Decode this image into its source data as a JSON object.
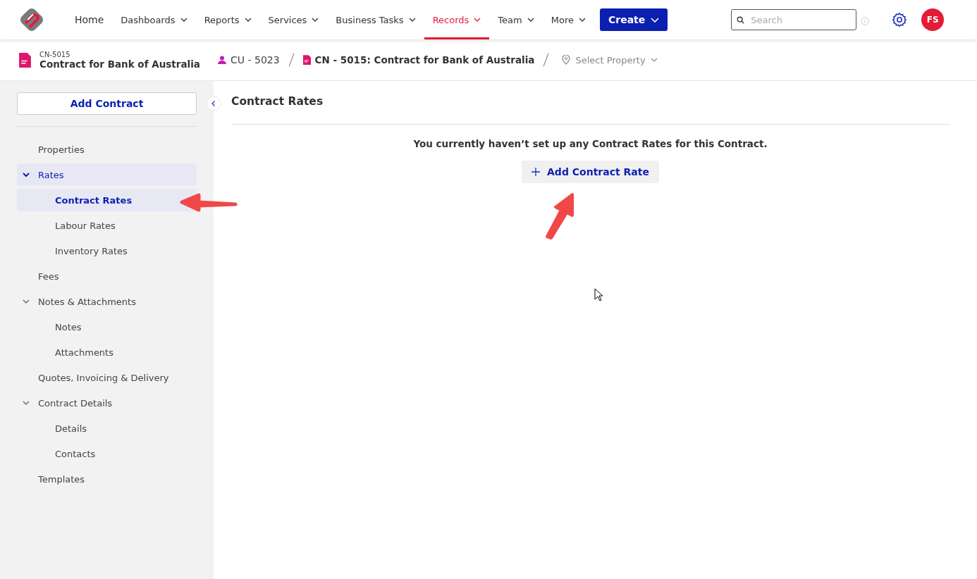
{
  "nav": {
    "items": [
      {
        "label": "Home",
        "dropdown": false,
        "selected": false
      },
      {
        "label": "Dashboards",
        "dropdown": true,
        "selected": false
      },
      {
        "label": "Reports",
        "dropdown": true,
        "selected": false
      },
      {
        "label": "Services",
        "dropdown": true,
        "selected": false
      },
      {
        "label": "Business Tasks",
        "dropdown": true,
        "selected": false
      },
      {
        "label": "Records",
        "dropdown": true,
        "selected": true
      },
      {
        "label": "Team",
        "dropdown": true,
        "selected": false
      },
      {
        "label": "More",
        "dropdown": true,
        "selected": false
      }
    ],
    "create_button": "Create",
    "search": {
      "placeholder": "Search"
    },
    "avatar": "FS"
  },
  "record": {
    "code": "CN-5015",
    "title": "Contract for Bank of Australia"
  },
  "breadcrumb": [
    {
      "kind": "customer",
      "label": "CU - 5023"
    },
    {
      "kind": "contract",
      "label": "CN - 5015: Contract for Bank of Australia"
    },
    {
      "kind": "property",
      "label": "Select Property"
    }
  ],
  "sidebar": {
    "add_button": "Add Contract",
    "items": [
      {
        "label": "Properties",
        "selected": false
      },
      {
        "label": "Rates",
        "selected": true,
        "expanded": true,
        "children": [
          {
            "label": "Contract Rates",
            "selected": true
          },
          {
            "label": "Labour Rates",
            "selected": false
          },
          {
            "label": "Inventory Rates",
            "selected": false
          }
        ]
      },
      {
        "label": "Fees",
        "selected": false
      },
      {
        "label": "Notes & Attachments",
        "selected": false,
        "expanded": true,
        "children": [
          {
            "label": "Notes",
            "selected": false
          },
          {
            "label": "Attachments",
            "selected": false
          }
        ]
      },
      {
        "label": "Quotes, Invoicing & Delivery",
        "selected": false
      },
      {
        "label": "Contract Details",
        "selected": false,
        "expanded": true,
        "children": [
          {
            "label": "Details",
            "selected": false
          },
          {
            "label": "Contacts",
            "selected": false
          }
        ]
      },
      {
        "label": "Templates",
        "selected": false
      }
    ]
  },
  "content": {
    "title": "Contract Rates",
    "empty_message": "You currently haven’t set up any Contract Rates for this Contract.",
    "add_button": "Add Contract Rate"
  }
}
